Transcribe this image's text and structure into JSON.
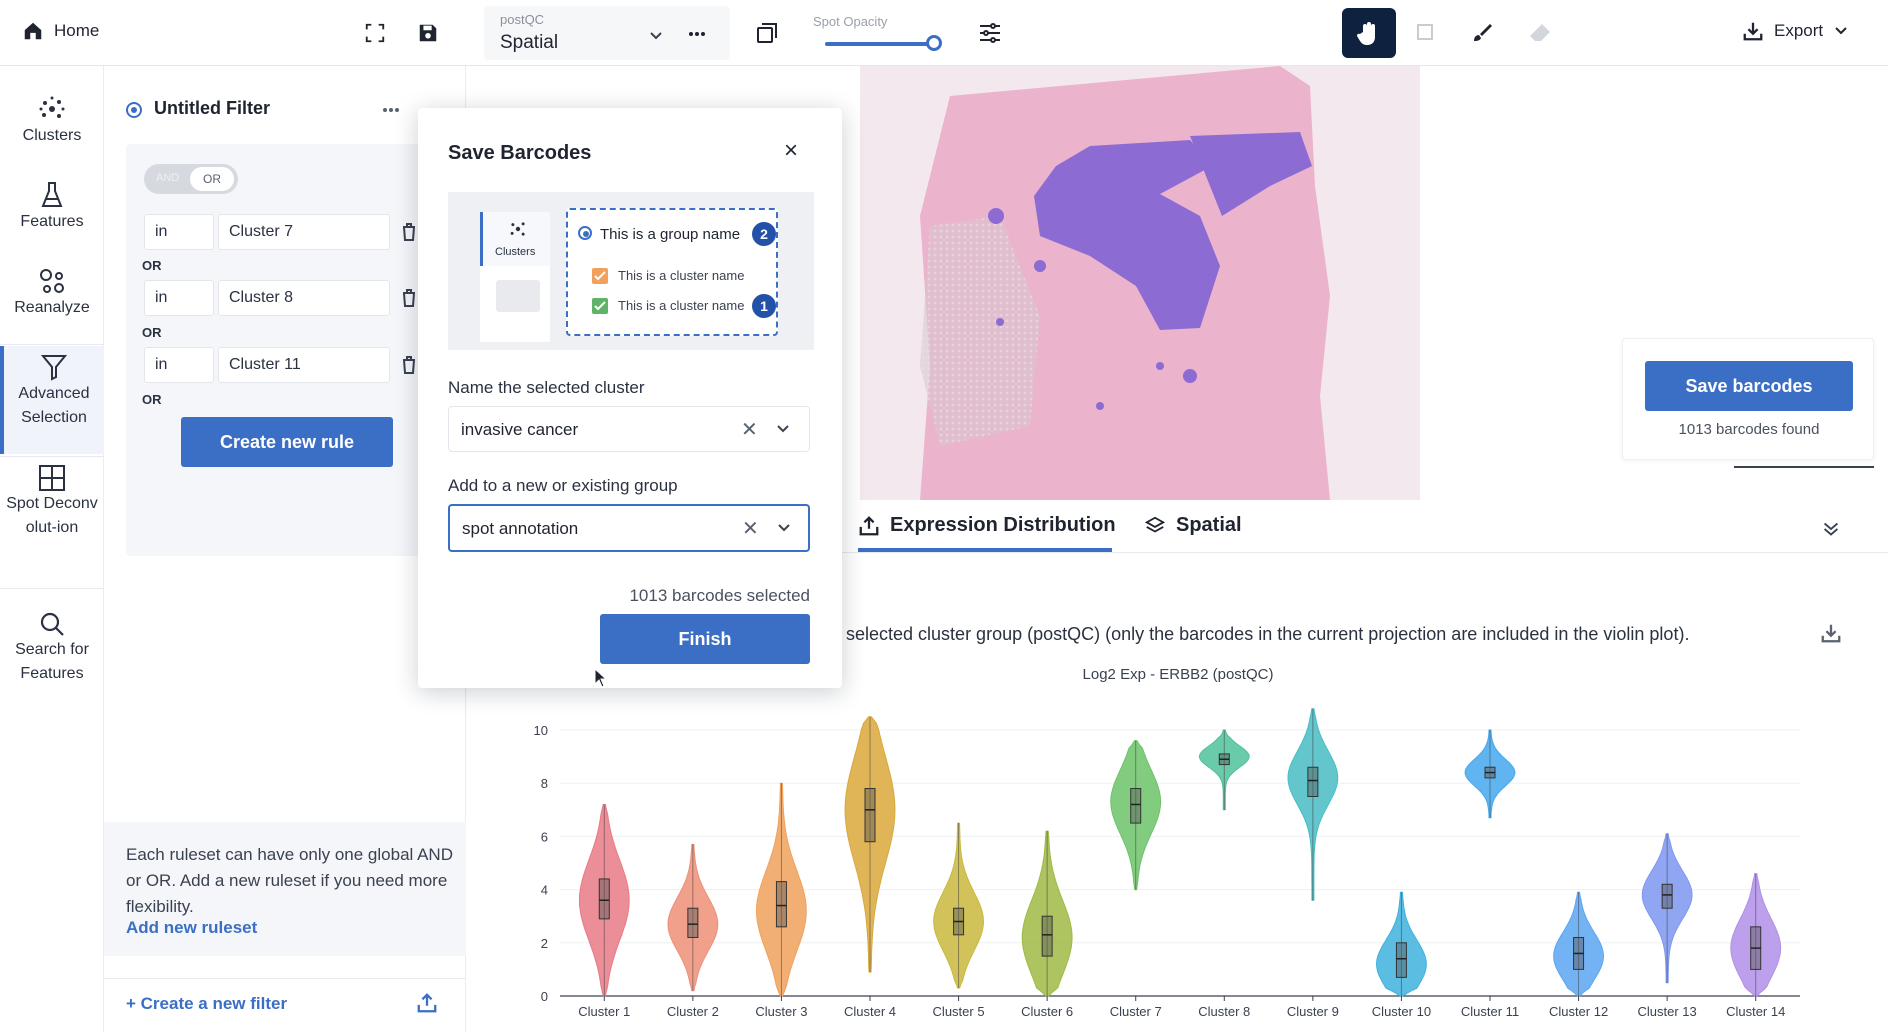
{
  "topbar": {
    "home_label": "Home",
    "projection_small": "postQC",
    "projection_main": "Spatial",
    "spot_opacity_label": "Spot Opacity",
    "export_label": "Export"
  },
  "nav": {
    "items": [
      {
        "label": "Clusters"
      },
      {
        "label": "Features"
      },
      {
        "label": "Reanalyze"
      },
      {
        "label": "Advanced Selection"
      },
      {
        "label": "Spot Deconvolut-ion"
      },
      {
        "label": "Search for Features"
      }
    ]
  },
  "filter": {
    "title": "Untitled Filter",
    "toggle_and": "AND",
    "toggle_or": "OR",
    "rules": [
      {
        "op": "in",
        "value": "Cluster 7",
        "joiner": "OR"
      },
      {
        "op": "in",
        "value": "Cluster 8",
        "joiner": "OR"
      },
      {
        "op": "in",
        "value": "Cluster 11",
        "joiner": "OR"
      }
    ],
    "create_rule_label": "Create new rule",
    "note": "Each ruleset can have only one global AND or OR. Add a new ruleset if you need more flexibility.",
    "add_ruleset_label": "Add new ruleset",
    "create_filter_label": "+ Create a new filter"
  },
  "modal": {
    "title": "Save Barcodes",
    "close": "×",
    "preview": {
      "nav_label": "Clusters",
      "group_name": "This is a group name",
      "cluster_name_1": "This is a cluster name",
      "cluster_name_2": "This is a cluster name",
      "badge_2": "2",
      "badge_1": "1"
    },
    "name_label": "Name the selected cluster",
    "name_value": "invasive cancer",
    "group_label": "Add to a new or existing group",
    "group_value": "spot annotation",
    "clear_glyph": "✕",
    "count_text": "1013 barcodes selected",
    "finish_label": "Finish"
  },
  "save_card": {
    "button_label": "Save barcodes",
    "found_text": "1013 barcodes found"
  },
  "tabs": [
    {
      "label": "Expression Distribution",
      "active": true
    },
    {
      "label": "Spatial",
      "active": false
    }
  ],
  "plot": {
    "description": "selected cluster group (postQC) (only the barcodes in the current projection are included in the violin plot).",
    "title": "Log2 Exp - ERBB2 (postQC)"
  },
  "chart_data": {
    "type": "violin",
    "title": "Log2 Exp - ERBB2 (postQC)",
    "ylim": [
      0,
      10
    ],
    "yticks": [
      0,
      2,
      4,
      6,
      8,
      10
    ],
    "categories": [
      "Cluster 1",
      "Cluster 2",
      "Cluster 3",
      "Cluster 4",
      "Cluster 5",
      "Cluster 6",
      "Cluster 7",
      "Cluster 8",
      "Cluster 9",
      "Cluster 10",
      "Cluster 11",
      "Cluster 12",
      "Cluster 13",
      "Cluster 14"
    ],
    "colors": [
      "#e87a86",
      "#ee8f78",
      "#f0a15c",
      "#d9a83a",
      "#c9b93c",
      "#9fba45",
      "#6cc36a",
      "#4fc29a",
      "#48bcc4",
      "#3fb2de",
      "#44a8ee",
      "#5aa6f2",
      "#7e97f0",
      "#b08fe8"
    ],
    "min": [
      0,
      0.2,
      0,
      0.9,
      0.3,
      0,
      4.0,
      7.0,
      3.6,
      0,
      6.7,
      0,
      0.5,
      0
    ],
    "q1": [
      2.9,
      2.2,
      2.6,
      5.8,
      2.3,
      1.5,
      6.5,
      8.7,
      7.5,
      0.7,
      8.2,
      1.0,
      3.3,
      1.0
    ],
    "median": [
      3.6,
      2.7,
      3.4,
      7.0,
      2.8,
      2.3,
      7.2,
      8.9,
      8.1,
      1.4,
      8.4,
      1.6,
      3.8,
      1.8
    ],
    "q3": [
      4.4,
      3.3,
      4.3,
      7.8,
      3.3,
      3.0,
      7.8,
      9.1,
      8.6,
      2.0,
      8.6,
      2.2,
      4.2,
      2.6
    ],
    "max": [
      7.2,
      5.7,
      8.0,
      10.5,
      6.5,
      6.2,
      9.6,
      10.0,
      10.8,
      3.9,
      10.0,
      3.9,
      6.1,
      4.6
    ],
    "peak": [
      3.6,
      2.7,
      3.2,
      7.0,
      2.8,
      2.2,
      7.3,
      9.0,
      8.2,
      1.2,
      8.4,
      1.5,
      3.8,
      1.8
    ],
    "spread": [
      1.5,
      1.0,
      1.5,
      2.0,
      1.1,
      1.4,
      1.2,
      0.4,
      1.0,
      0.9,
      0.5,
      0.9,
      0.9,
      1.1
    ]
  }
}
